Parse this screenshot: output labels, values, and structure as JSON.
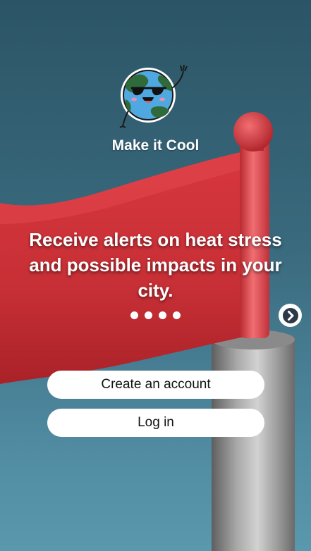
{
  "app": {
    "name": "Make it Cool"
  },
  "onboarding": {
    "headline": "Receive alerts on heat stress and possible impacts in your city.",
    "page_indicator": {
      "total": 4
    },
    "next_icon": "chevron-right-icon"
  },
  "actions": {
    "create_account_label": "Create an account",
    "login_label": "Log in"
  },
  "colors": {
    "flag_red": "#d8373e",
    "sky_top": "#2b5566",
    "sky_bottom": "#5a98ae",
    "button_bg": "#ffffff"
  }
}
